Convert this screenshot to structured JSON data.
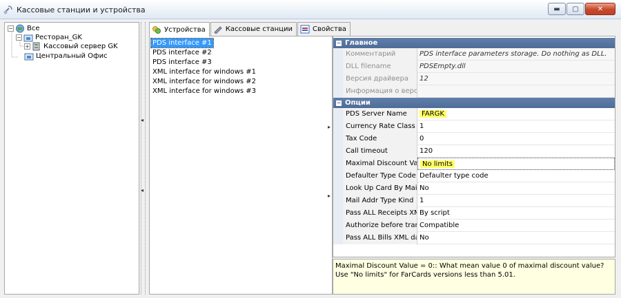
{
  "window": {
    "title": "Кассовые станции и устройства",
    "icon": "satellite-icon",
    "buttons": {
      "minimize": "▬",
      "maximize": "▢",
      "close": "✕"
    }
  },
  "tree": {
    "root": {
      "label": "Все",
      "expander": "−"
    },
    "restaurant": {
      "label": "Ресторан_GK",
      "expander": "−"
    },
    "cash_server": {
      "label": "Кассовый сервер GK",
      "expander": "+"
    },
    "central_office": {
      "label": "Центральный Офис"
    }
  },
  "splitters": {
    "collapse_left": "◂",
    "expand_right": "▸"
  },
  "tabs": [
    {
      "label": "Устройства",
      "icon": "devices-icon"
    },
    {
      "label": "Кассовые станции",
      "icon": "pen-icon"
    },
    {
      "label": "Свойства",
      "icon": "properties-icon"
    }
  ],
  "devices": [
    "PDS interface #1",
    "PDS interface #2",
    "PDS interface #3",
    "XML interface for windows #1",
    "XML interface for windows #2",
    "XML interface for windows #3"
  ],
  "property_grid": {
    "main_category": "Главное",
    "category_toggle": "−",
    "main": [
      {
        "name": "Комментарий",
        "value": "PDS interface parameters storage. Do nothing as DLL."
      },
      {
        "name": "DLL filename",
        "value": "PDSEmpty.dll"
      },
      {
        "name": "Версия драйвера",
        "value": "12"
      },
      {
        "name": "Информация о версии",
        "value": ""
      }
    ],
    "options_category": "Опции",
    "options": [
      {
        "name": "PDS Server Name",
        "value": "FARGK"
      },
      {
        "name": "Currency Rate Class Code",
        "value": "1"
      },
      {
        "name": "Tax Code",
        "value": "0"
      },
      {
        "name": "Call timeout",
        "value": "120"
      },
      {
        "name": "Maximal Discount Value",
        "value": "No limits"
      },
      {
        "name": "Defaulter Type Code as",
        "value": "Defaulter type code"
      },
      {
        "name": "Look Up Card By Mail Addr",
        "value": "No"
      },
      {
        "name": "Mail Addr Type Kind",
        "value": "1"
      },
      {
        "name": "Pass ALL Receipts XML",
        "value": "By script"
      },
      {
        "name": "Authorize before transaction",
        "value": "Compatible"
      },
      {
        "name": "Pass ALL Bills XML data",
        "value": "No"
      }
    ]
  },
  "description": "Maximal Discount Value = 0:: What mean value 0 of maximal discount value? Use \"No limits\" for FarCards versions less than 5.01.",
  "colors": {
    "highlight": "#ffff66",
    "category_bar": "#4e6c98",
    "selection": "#3399ff"
  }
}
